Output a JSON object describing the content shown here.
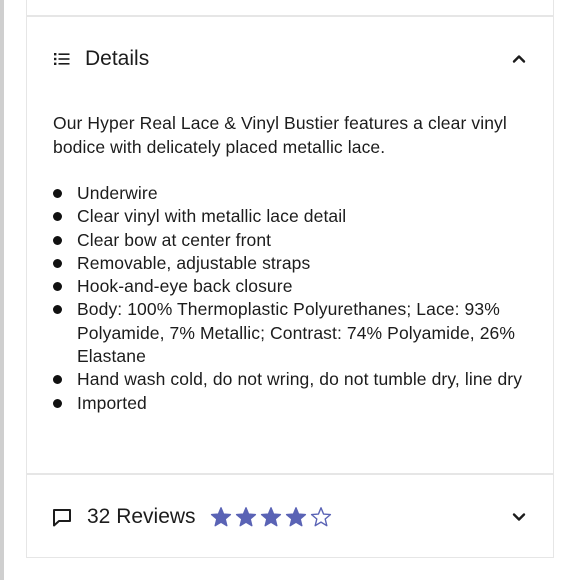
{
  "details": {
    "title": "Details",
    "description": "Our Hyper Real Lace & Vinyl Bustier features a clear vinyl bodice with delicately placed metallic lace.",
    "bullets": [
      "Underwire",
      "Clear vinyl with metallic lace detail",
      "Clear bow at center front",
      "Removable, adjustable straps",
      "Hook-and-eye back closure",
      "Body: 100% Thermoplastic Polyurethanes; Lace: 93% Polyamide, 7% Metallic; Contrast: 74% Polyamide, 26% Elastane",
      "Hand wash cold, do not wring, do not tumble dry, line dry",
      "Imported"
    ],
    "icon": "list-icon",
    "toggle_icon": "chevron-up-icon"
  },
  "reviews": {
    "label": "32 Reviews",
    "rating": 4,
    "max_rating": 5,
    "icon": "comment-icon",
    "toggle_icon": "chevron-down-icon"
  },
  "colors": {
    "star": "#5a63b5",
    "text": "#1c1c1c",
    "border": "#e6e6e6"
  }
}
